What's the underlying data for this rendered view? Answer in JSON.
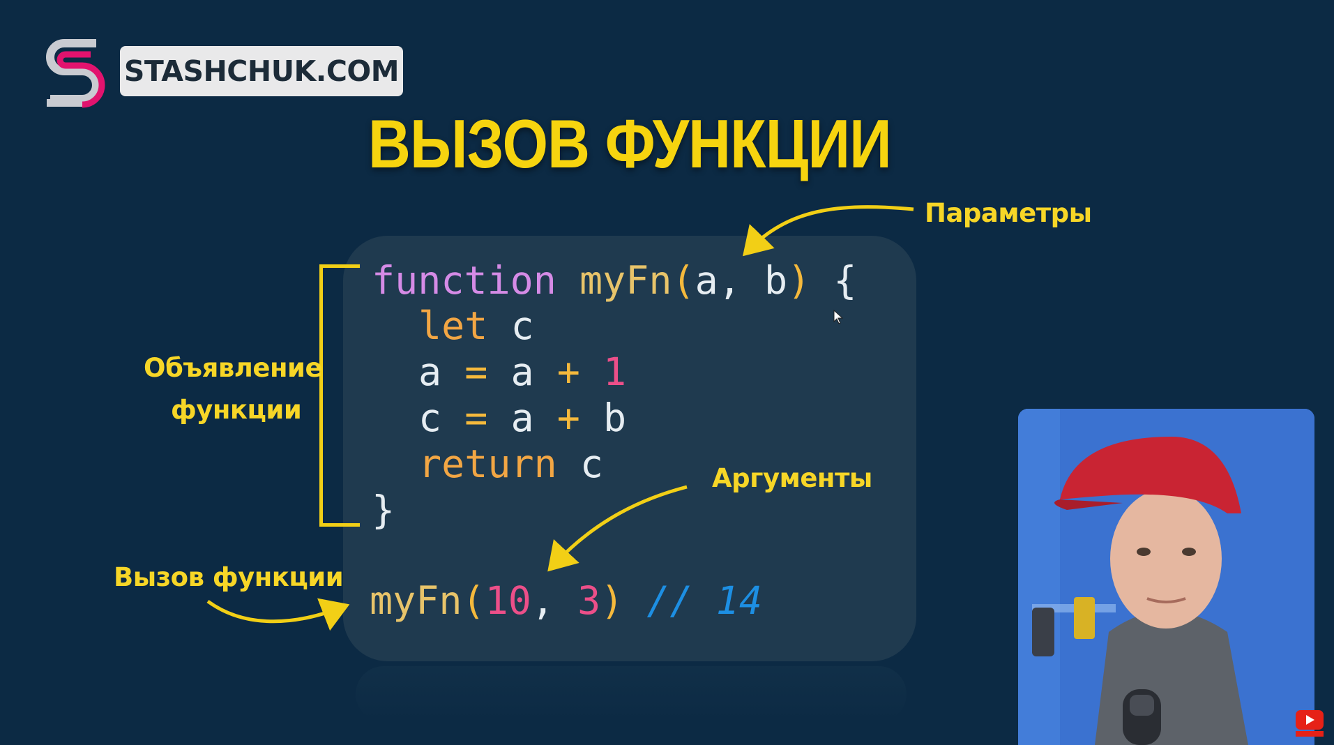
{
  "brand": {
    "name": "STASHCHUK.COM"
  },
  "title": "ВЫЗОВ ФУНКЦИИ",
  "code": {
    "line1": {
      "keyword": "function",
      "name": "myFn",
      "open": "(",
      "param_a": "a",
      "comma": ",",
      "param_b": "b",
      "close": ")",
      "brace": "{"
    },
    "line2": {
      "keyword": "let",
      "var": "c"
    },
    "line3": {
      "lhs": "a",
      "eq": "=",
      "a": "a",
      "plus": "+",
      "num": "1"
    },
    "line4": {
      "lhs": "c",
      "eq": "=",
      "a": "a",
      "plus": "+",
      "b": "b"
    },
    "line5": {
      "keyword": "return",
      "var": "c"
    },
    "line6": {
      "brace": "}"
    },
    "call": {
      "name": "myFn",
      "open": "(",
      "arg1": "10",
      "comma": ",",
      "arg2": "3",
      "close": ")",
      "comment": "// 14"
    }
  },
  "labels": {
    "params": "Параметры",
    "declaration_line1": "Объявление",
    "declaration_line2": "функции",
    "arguments": "Аргументы",
    "call": "Вызов функции"
  },
  "colors": {
    "background": "#0c2a44",
    "title_yellow": "#f6d40f",
    "keyword_purple": "#d58be6",
    "number_pink": "#ec4f89",
    "comment_blue": "#1d8fe3"
  },
  "icons": [
    "stashchuk-logo-icon",
    "cursor-icon",
    "youtube-subscribe-icon"
  ]
}
